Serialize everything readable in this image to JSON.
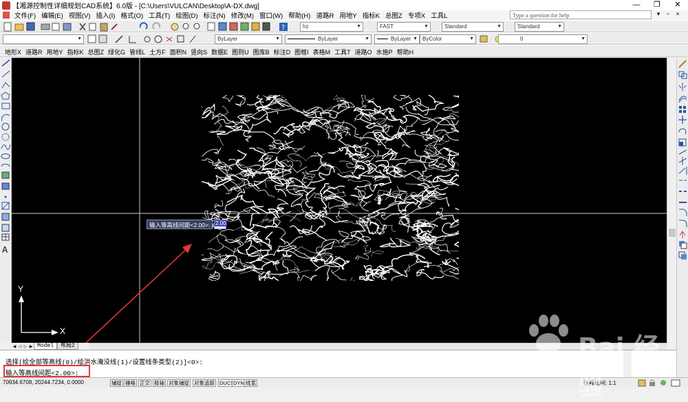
{
  "window": {
    "title": "【湘源控制性详细规划CAD系统】6.0版 - [C:\\Users\\VULCAN\\Desktop\\A-DX.dwg]",
    "controls": [
      "—",
      "❐",
      "✕"
    ]
  },
  "menubar": {
    "items": [
      "文件(F)",
      "编辑(E)",
      "视图(V)",
      "插入(I)",
      "格式(O)",
      "工具(T)",
      "绘图(D)",
      "标注(N)",
      "修改(M)",
      "窗口(W)",
      "帮助(H)",
      "道路R",
      "用地Y",
      "指标K",
      "总图Z",
      "专项X",
      "工具L"
    ],
    "help_placeholder": "Type a question for help",
    "help_buttons": [
      "▾",
      "−",
      "×"
    ]
  },
  "toolbar1": {
    "layer_combo": "hz",
    "font_combo": "FAST",
    "dim_style_combo": "Standard",
    "text_style_combo": "Standard"
  },
  "toolbar2": {
    "color_combo": "ByLayer",
    "linetype_combo": "ByLayer",
    "lineweight_combo": "ByLayer",
    "plotstyle_combo": "ByColor",
    "layer_state": "0"
  },
  "toolbar3": {
    "items": [
      "地形X",
      "道路R",
      "用地Y",
      "指标K",
      "总图Z",
      "绿化G",
      "管线L",
      "土方F",
      "面积N",
      "竖向S",
      "数据E",
      "图则U",
      "图库B",
      "标注D",
      "图框I",
      "表格M",
      "工具T",
      "道路O",
      "水施P",
      "帮助H"
    ]
  },
  "canvas": {
    "background": "#000000",
    "ucs_y": "Y",
    "ucs_x": "X"
  },
  "dynamic_input": {
    "prompt": "输入等高线间距<2.00>:",
    "value": "2.00"
  },
  "tabs": {
    "nav": [
      "◀",
      "◁",
      "▷",
      "▶"
    ],
    "model": "Model",
    "layout": "布局2"
  },
  "command": {
    "line1": "选择[绘全部等高线(0)/绘洪水淹没线(1)/设置线条类型(2)]<0>:",
    "line2": "输入等高线间距<2.00>:"
  },
  "status": {
    "coords": "70934.6708, 20244.7234, 0.0000",
    "buttons": [
      "捕捉",
      "栅格",
      "正交",
      "极轴",
      "对象捕捉",
      "对象追踪",
      "DUCS",
      "DYN",
      "线宽"
    ],
    "scale_label": "注释比例: 1:1"
  },
  "watermark": {
    "brand": "Bai  经验",
    "url": "jingyan.baidu.com"
  },
  "colors": {
    "accent_red": "#e53935",
    "tooltip_bg": "#3a3f5e"
  }
}
